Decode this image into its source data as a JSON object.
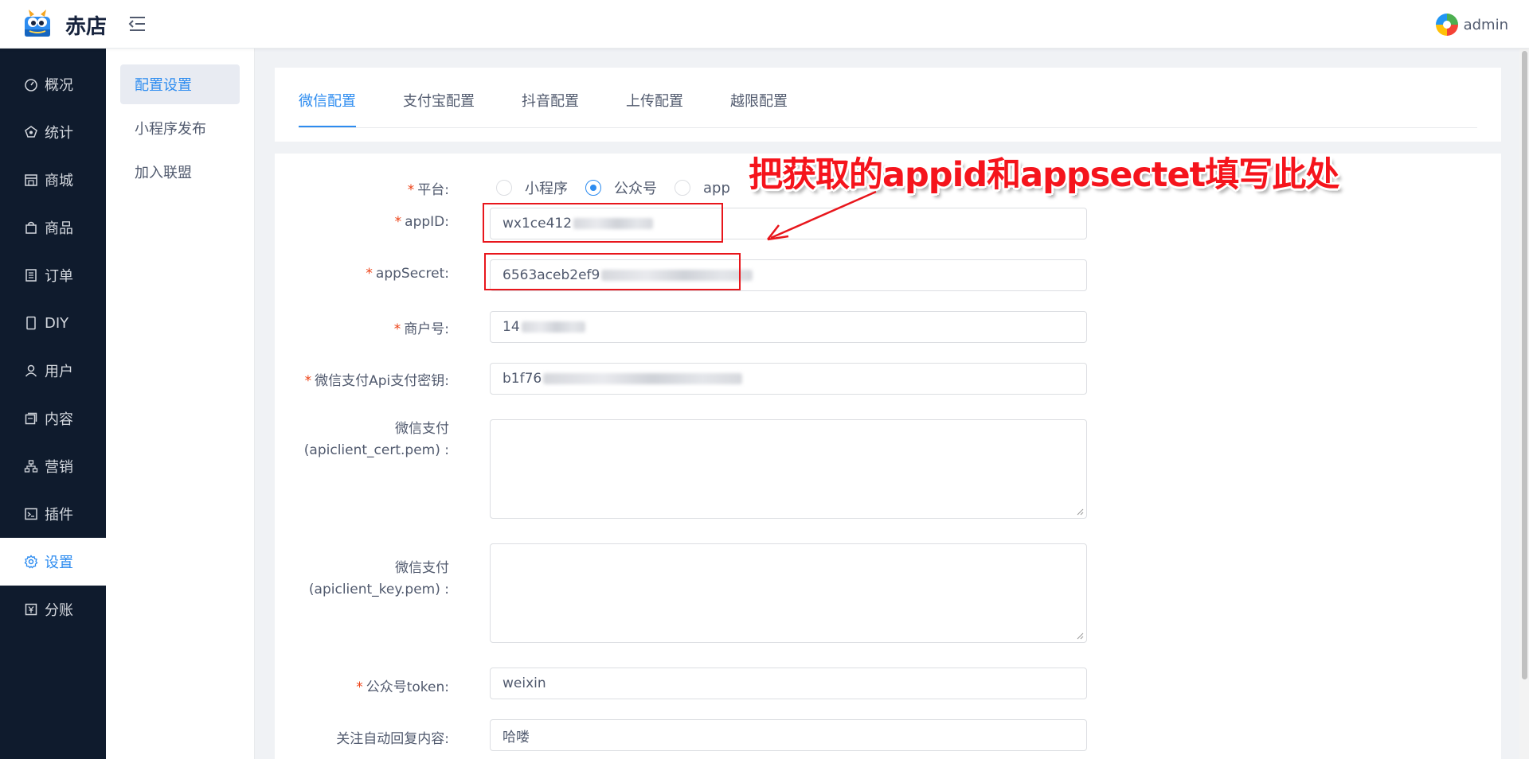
{
  "header": {
    "app_name": "赤店",
    "user_name": "admin"
  },
  "sidebar": {
    "items": [
      {
        "label": "概况",
        "icon": "dashboard-icon"
      },
      {
        "label": "统计",
        "icon": "stats-icon"
      },
      {
        "label": "商城",
        "icon": "shop-icon"
      },
      {
        "label": "商品",
        "icon": "bag-icon"
      },
      {
        "label": "订单",
        "icon": "order-icon"
      },
      {
        "label": "DIY",
        "icon": "phone-icon"
      },
      {
        "label": "用户",
        "icon": "user-icon"
      },
      {
        "label": "内容",
        "icon": "content-icon"
      },
      {
        "label": "营销",
        "icon": "marketing-icon"
      },
      {
        "label": "插件",
        "icon": "plugin-icon"
      },
      {
        "label": "设置",
        "icon": "gear-icon"
      },
      {
        "label": "分账",
        "icon": "yen-icon"
      }
    ],
    "active": "设置"
  },
  "subnav": {
    "items": [
      "配置设置",
      "小程序发布",
      "加入联盟"
    ],
    "active": "配置设置"
  },
  "tabs": {
    "items": [
      "微信配置",
      "支付宝配置",
      "抖音配置",
      "上传配置",
      "越限配置"
    ],
    "active": "微信配置"
  },
  "form": {
    "platform_label": "平台:",
    "platform_options": [
      "小程序",
      "公众号",
      "app"
    ],
    "platform_selected": "公众号",
    "appid_label": "appID:",
    "appid_value": "wx1ce412",
    "appsecret_label": "appSecret:",
    "appsecret_value": "6563aceb2ef9",
    "merchant_label": "商户号:",
    "merchant_value": "14",
    "api_key_label": "微信支付Api支付密钥:",
    "api_key_value": "b1f76",
    "cert_label_line1": "微信支付",
    "cert_label_line2": "(apiclient_cert.pem) :",
    "key_label_line1": "微信支付",
    "key_label_line2": "(apiclient_key.pem) :",
    "token_label": "公众号token:",
    "token_value": "weixin",
    "reply_label": "关注自动回复内容:",
    "reply_value": "哈喽"
  },
  "annotation": {
    "text": "把获取的appid和appsectet填写此处",
    "color": "#f5141c"
  },
  "colors": {
    "accent": "#2d8cf0",
    "sidebar_bg": "#0f1b2d",
    "required": "#ed4014"
  }
}
